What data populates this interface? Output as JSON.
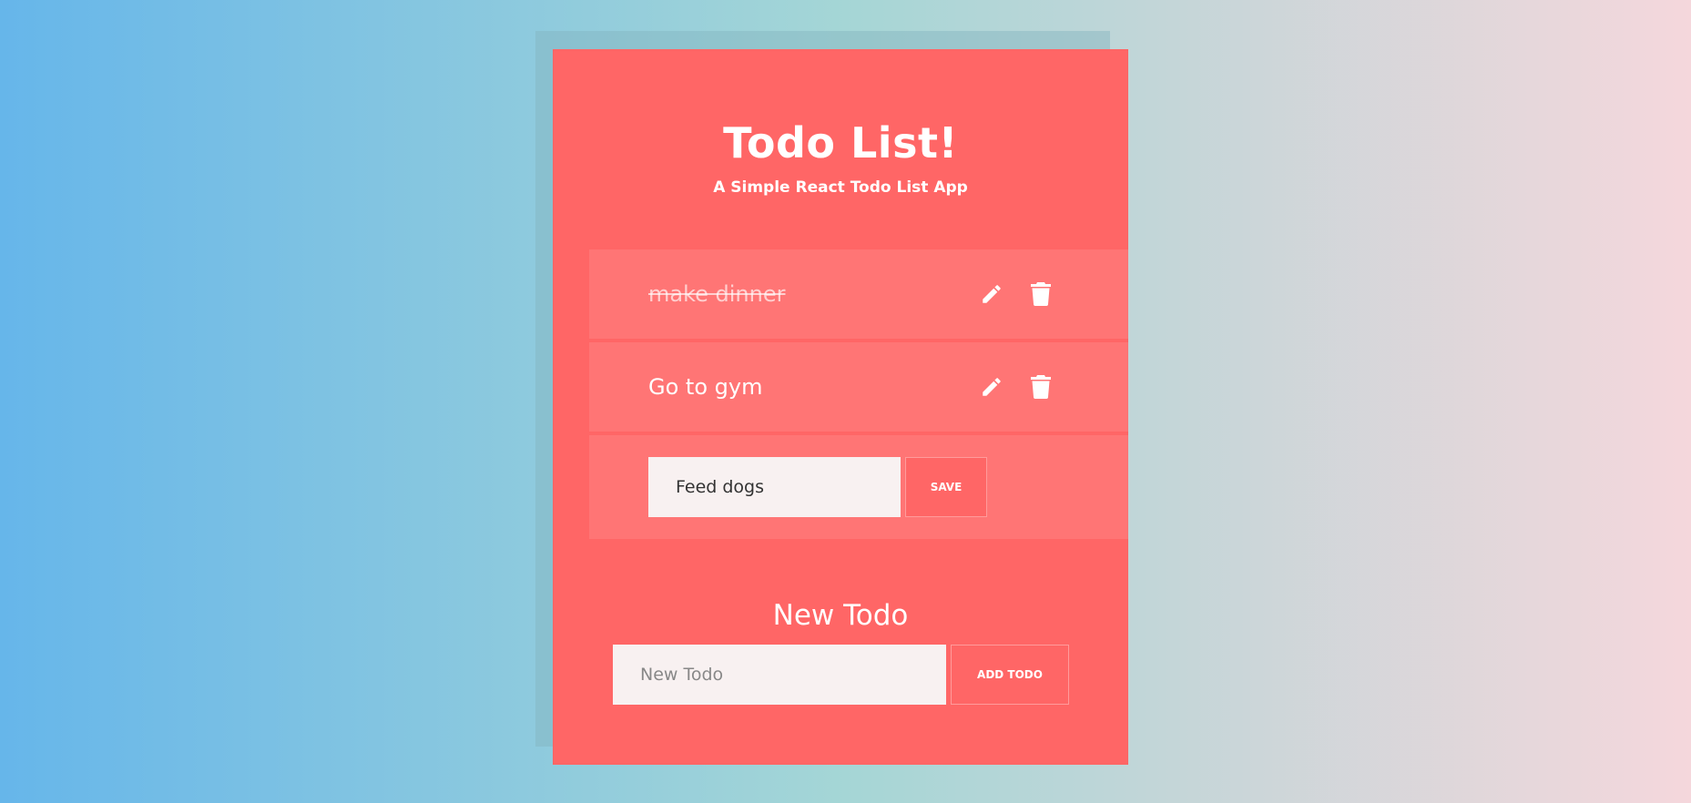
{
  "app": {
    "title": "Todo List!",
    "subtitle": "A Simple React Todo List App"
  },
  "todos": [
    {
      "text": "make dinner",
      "completed": true,
      "edit_icon": "pencil-icon",
      "delete_icon": "trash-icon"
    },
    {
      "text": "Go to gym",
      "completed": false,
      "edit_icon": "pencil-icon",
      "delete_icon": "trash-icon"
    }
  ],
  "editing": {
    "value": "Feed dogs",
    "save_label": "SAVE"
  },
  "new_todo": {
    "heading": "New Todo",
    "placeholder": "New Todo",
    "value": "",
    "add_label": "ADD TODO"
  },
  "colors": {
    "card": "#ff6666",
    "item": "#ff7575",
    "input_bg": "#f8f1f1",
    "bg_left": "#66b6ea",
    "bg_right": "#f5d7dc"
  }
}
